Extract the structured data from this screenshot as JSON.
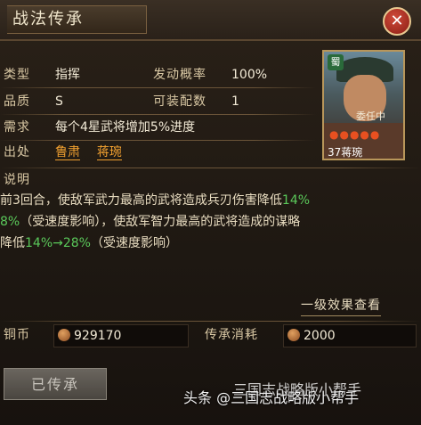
{
  "header": {
    "title": "战法传承",
    "close_glyph": "✕"
  },
  "info": {
    "type_label": "类型",
    "type_value": "指挥",
    "rate_label": "发动概率",
    "rate_value": "100%",
    "quality_label": "品质",
    "quality_value": "S",
    "equip_label": "可装配数",
    "equip_value": "1",
    "req_label": "需求",
    "req_value": "每个4星武将增加5%进度",
    "source_label": "出处",
    "source_1": "鲁肃",
    "source_2": "蒋琬"
  },
  "portrait": {
    "faction": "蜀",
    "name": "委任中",
    "stars": "●●●●●",
    "level_name": "37蒋琬"
  },
  "description": {
    "heading": "说明",
    "line1_a": "前3回合，使敌军武力最高的武将造成兵刃伤害降低",
    "line1_b": "14%",
    "line2_a": "8%",
    "line2_b": "（受速度影响），使敌军智力最高的武将造成的谋略",
    "line3_a": "降低",
    "line3_b": "14%→28%",
    "line3_c": "（受速度影响）"
  },
  "view_level1": "一级效果查看",
  "cost": {
    "copper_label": "铜币",
    "copper_value": "929170",
    "inherit_label": "传承消耗",
    "inherit_value": "2000"
  },
  "action": {
    "inherited_label": "已传承"
  },
  "watermark": {
    "prefix": "头条",
    "text": "@三国志战略版小帮手",
    "ghost": "三国志战略版小帮手"
  }
}
